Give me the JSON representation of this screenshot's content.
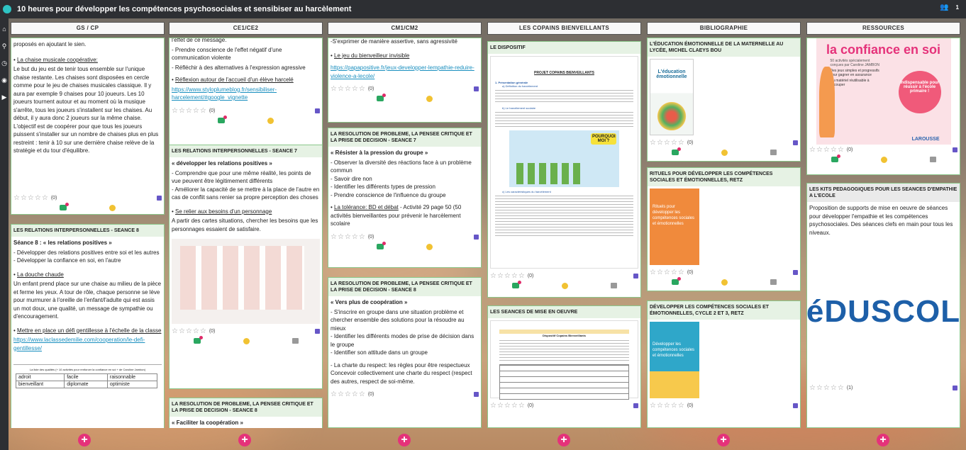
{
  "app": {
    "title": "10 heures pour développer les compétences psychosociales et sensibiser au harcèlement",
    "member_count": "1"
  },
  "columns": [
    {
      "header": "GS / CP"
    },
    {
      "header": "CE1/CE2"
    },
    {
      "header": "CM1/CM2"
    },
    {
      "header": "LES COPAINS BIENVEILLANTS"
    },
    {
      "header": "BIBLIOGRAPHIE"
    },
    {
      "header": "RESSOURCES"
    }
  ],
  "gs": {
    "c1": {
      "l1": "proposés en ajoutant le sien.",
      "sub": "La chaise musicale coopérative:",
      "text": "Le but du jeu est de tenir tous ensemble sur l'unique chaise restante. Les chaises sont disposées en cercle comme pour le jeu de chaises musicales classique. Il y aura par exemple 9 chaises pour 10 joueurs. Les 10 joueurs tournent autour et au moment où la musique s'arrête, tous les joueurs s'installent sur les chaises. Au début, il y aura donc 2 joueurs sur la même chaise. L'objectif est de coopérer pour que tous les joueurs puissent s'installer sur un nombre de chaises plus en plus restreint : tenir à 10 sur une dernière chaise relève de la stratégie et du tour d'équilibre.",
      "rating": "(0)"
    },
    "c2": {
      "title": "LES RELATIONS INTERPERSONNELLES - SEANCE 8",
      "h": "Séance 8 : « les relations positives »",
      "l1": "- Développer des relations positives entre soi et les autres",
      "l2": "- Développer la confiance en soi, en l'autre",
      "sub1": "La douche chaude",
      "t1": "Un enfant prend place sur une chaise au milieu de la pièce et ferme les yeux. A tour de rôle, chaque personne se lève pour murmurer à l'oreille de l'enfant/l'adulte qui est assis un mot doux, une qualité, un message de sympathie ou d'encouragement.",
      "sub2": "Mettre en place un défi gentillesse à l'échelle de la classe",
      "link": "https://www.laclassedemilie.com/cooperation/le-defi-gentillesse/",
      "table_title": "La liste des qualités (+ 10 activités pour renforcer la confiance en soi + de Caroline Jambon)",
      "rows": [
        [
          "adroit",
          "facile",
          "raisonnable"
        ],
        [
          "bienveillant",
          "diplomate",
          "optimiste"
        ]
      ]
    }
  },
  "ce": {
    "c1": {
      "l0": "l'effet de ce message.",
      "l1": "- Prendre conscience de l'effet négatif d'une communication violente",
      "l2": "- Réfléchir à des alternatives à l'expression agressive",
      "l3": "Réflexion autour de l'accueil d'un élève harcelé",
      "link": "https://www.styloplumeblog.fr/sensibiliser-harcelement/#google_vignette",
      "rating": "(0)"
    },
    "c2": {
      "title": "LES RELATIONS INTERPERSONNELLES - SEANCE 7",
      "h": "« développer les relations positives »",
      "l1": "- Comprendre que pour une même réalité, les points de vue peuvent être légitimement différents",
      "l2": "- Améliorer la capacité de se mettre à la place de l'autre en cas de conflit sans renier sa propre perception des choses",
      "sub": "Se relier aux besoins d'un personnage",
      "t": "A partir des cartes situations, chercher les besoins que les personnages essaient de satisfaire.",
      "rating": "(0)"
    },
    "c3": {
      "title": "LA RESOLUTION DE PROBLEME, LA PENSEE CRITIQUE ET LA PRISE DE DECISION - SEANCE 8",
      "h": "« Faciliter la coopération »"
    }
  },
  "cm": {
    "c1": {
      "l0": "-S'exprimer de manière assertive, sans agressivité",
      "sub": "Le jeu du bienveilleur invisible",
      "link": "https://papapositive.fr/jeux-developper-lempathie-reduire-violence-a-lecole/",
      "rating": "(0)"
    },
    "c2": {
      "title": "LA RESOLUTION DE PROBLEME, LA PENSEE CRITIQUE ET LA PRISE DE DECISION - SEANCE 7",
      "h": "« Résister à la pression du groupe »",
      "l1": "- Observer la diversité des réactions face à un problème commun",
      "l2": "- Savoir dire non",
      "l3": "- Identifier les différents types de pression",
      "l4": "- Prendre conscience de l'influence du groupe",
      "sub": "La tolérance: BD et débat",
      "t": " - Activité 29 page 50 (50 activités bienveillantes pour prévenir le harcèlement scolaire",
      "rating": "(0)"
    },
    "c3": {
      "title": "LA RESOLUTION DE PROBLEME, LA PENSEE CRITIQUE ET LA PRISE DE DECISION - SEANCE 8",
      "h": "« Vers plus de coopération »",
      "l1": "- S'inscrire en groupe dans une situation problème et chercher ensemble des solutions pour la résoudre au mieux",
      "l2": "- Identifier les différents modes de prise de décision dans le groupe",
      "l3": "- Identifier son attitude dans un groupe",
      "l4": "- La charte du respect: les règles pour être respectueux Concevoir collectivement une charte du respect (respect des autres, respect de soi-même.",
      "rating": "(0)"
    }
  },
  "copains": {
    "c1": {
      "title": "LE DISPOSITIF",
      "doc_title": "PROJET COPAINS BIENVEILLANTS",
      "doc_h1": "1.   Présentation générale",
      "doc_h2": "a)  Définition du harcèlement",
      "doc_h3": "b)  Le harcèlement scolaire",
      "speech": "POURQUOI MOI ?",
      "doc_h4": "c)  Les caractéristiques du harcèlement",
      "rating": "(0)"
    },
    "c2": {
      "title": "LES SEANCES DE MISE EN OEUVRE",
      "doc_title": "Dispositif Copains Bienveillants",
      "rating": "(0)"
    }
  },
  "biblio": {
    "c1": {
      "title": "L'ÉDUCATION ÉMOTIONNELLE DE LA MATERNELLE AU LYCÉE, MICHEL CLAEYS BOU",
      "book": "L'éducation émotionnelle",
      "rating": "(0)"
    },
    "c2": {
      "title": "RITUELS POUR DÉVELOPPER LES COMPÉTENCES SOCIALES ET ÉMOTIONNELLES, RETZ",
      "book": "Rituels pour développer les compétences sociales et émotionnelles",
      "rating": "(0)"
    },
    "c3": {
      "title": "DÉVELOPPER LES COMPÉTENCES SOCIALES ET ÉMOTIONNELLES, CYCLE 2 ET 3, RETZ",
      "book": "Développer les compétences sociales et émotionnelles",
      "rating": "(0)"
    }
  },
  "ressources": {
    "c1": {
      "book": "la confiance en soi",
      "sub": "50 activités spécialement conçues par Caroline JAMBON",
      "b1": "Des jeux simples et progressifs pour gagner en assurance",
      "b2": "Du matériel réutilisable à découper",
      "badge": "Indispensable pour réussir à l'école primaire !",
      "publisher": "LAROUSSE",
      "rating": "(0)"
    },
    "c2": {
      "title": "LES KITS PEDAGOGIQUES POUR LES SEANCES D'EMPATHIE A L'ECOLE",
      "t": "Proposition de supports de mise en oeuvre de séances pour développer l'empathie et les compétences psychosociales. Des séances clefs en main pour tous les niveaux.",
      "logo": "éDUSCOL",
      "rating": "(1)"
    }
  },
  "ui": {
    "add": "+",
    "stars": "☆☆☆☆☆"
  }
}
